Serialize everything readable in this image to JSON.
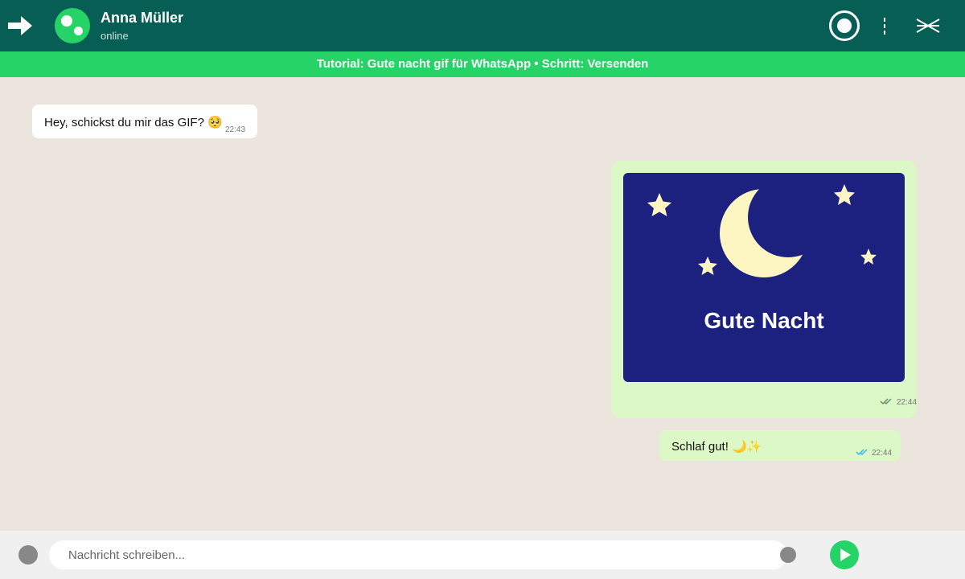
{
  "header": {
    "back_icon": "arrow-right-icon",
    "contact_name": "Anna Müller",
    "contact_status": "online",
    "record_icon": "record-icon",
    "menu_icon": "more-vertical-icon",
    "close_icon": "close-icon",
    "background_color": "#075e54"
  },
  "banner": {
    "text": "Tutorial: Gute nacht gif für WhatsApp • Schritt: Versenden",
    "background_color": "#25d366"
  },
  "messages": [
    {
      "direction": "incoming",
      "text": "Hey, schickst du mir das GIF? 🥺",
      "time": "22:43"
    },
    {
      "direction": "outgoing",
      "type": "gif",
      "gif_title": "Gute Nacht",
      "time": "22:44",
      "status": "delivered"
    },
    {
      "direction": "outgoing",
      "text": "Schlaf gut! 🌙✨",
      "time": "22:44",
      "status": "read"
    }
  ],
  "composer": {
    "placeholder": "Nachricht schreiben...",
    "value": "",
    "emoji_icon": "emoji-icon",
    "attach_icon": "attach-icon",
    "send_icon": "send-icon"
  },
  "colors": {
    "chat_background": "#ece5dd",
    "outgoing_bubble": "#dcf8c6",
    "incoming_bubble": "#ffffff",
    "gif_background": "#1c2180",
    "read_ticks": "#34b7f1"
  }
}
